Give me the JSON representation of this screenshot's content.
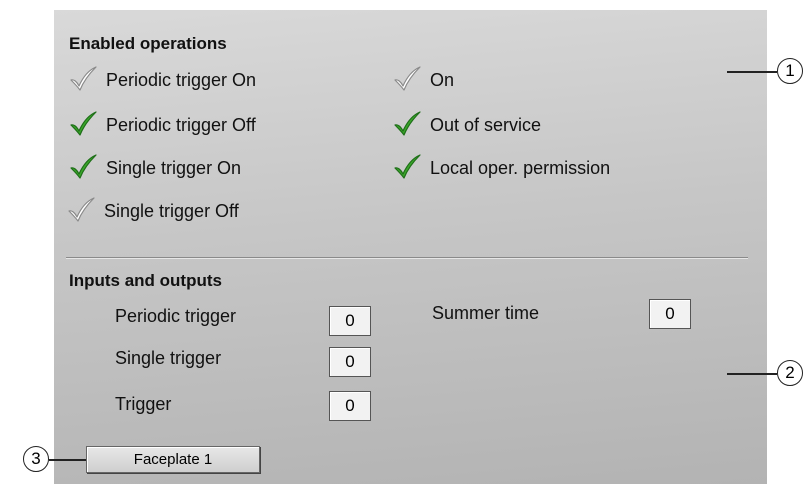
{
  "enabled_operations": {
    "title": "Enabled operations",
    "left": [
      {
        "label": "Periodic trigger On",
        "enabled": false
      },
      {
        "label": "Periodic trigger Off",
        "enabled": true
      },
      {
        "label": "Single trigger On",
        "enabled": true
      },
      {
        "label": "Single trigger Off",
        "enabled": false
      }
    ],
    "right": [
      {
        "label": "On",
        "enabled": false
      },
      {
        "label": "Out of service",
        "enabled": true
      },
      {
        "label": "Local oper. permission",
        "enabled": true
      }
    ]
  },
  "inputs_outputs": {
    "title": "Inputs and outputs",
    "periodic_trigger": {
      "label": "Periodic trigger",
      "value": "0"
    },
    "single_trigger": {
      "label": "Single trigger",
      "value": "0"
    },
    "trigger": {
      "label": "Trigger",
      "value": "0"
    },
    "summer_time": {
      "label": "Summer time",
      "value": "0"
    }
  },
  "faceplate_button": {
    "label": "Faceplate 1"
  },
  "callouts": {
    "c1": "1",
    "c2": "2",
    "c3": "3"
  },
  "colors": {
    "check_enabled": "#3aa52a",
    "check_disabled": "#ffffff"
  }
}
